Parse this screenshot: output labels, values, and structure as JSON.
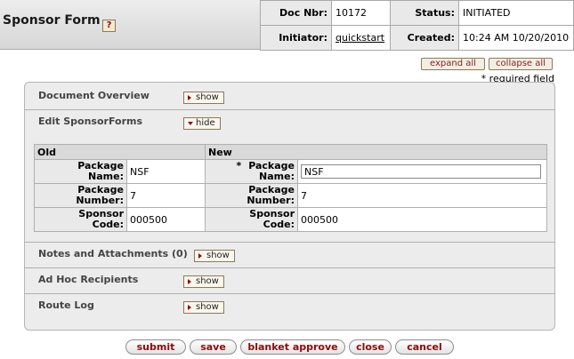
{
  "header": {
    "title": "Sponsor Form",
    "help_glyph": "?",
    "doc_nbr_label": "Doc Nbr:",
    "doc_nbr": "10172",
    "status_label": "Status:",
    "status": "INITIATED",
    "initiator_label": "Initiator:",
    "initiator": "quickstart",
    "created_label": "Created:",
    "created": "10:24 AM 10/20/2010"
  },
  "toolbar": {
    "expand_all": "expand all",
    "collapse_all": "collapse all",
    "required_note": "* required field"
  },
  "tabs": {
    "document_overview": {
      "label": "Document Overview",
      "button": "show"
    },
    "edit_sponsor_forms": {
      "label": "Edit SponsorForms",
      "button": "hide"
    },
    "notes": {
      "label": "Notes and Attachments (0)",
      "button": "show"
    },
    "ad_hoc": {
      "label": "Ad Hoc Recipients",
      "button": "show"
    },
    "route_log": {
      "label": "Route Log",
      "button": "show"
    }
  },
  "table": {
    "old_header": "Old",
    "new_header": "New",
    "required_marker": "*",
    "rows": [
      {
        "label_1": "Package",
        "label_2": "Name:",
        "old": "NSF",
        "new": "NSF"
      },
      {
        "label_1": "Package",
        "label_2": "Number:",
        "old": "7",
        "new": "7"
      },
      {
        "label_1": "Sponsor",
        "label_2": "Code:",
        "old": "000500",
        "new": "000500"
      }
    ]
  },
  "actions": {
    "submit": "submit",
    "save": "save",
    "blanket_approve": "blanket approve",
    "close": "close",
    "cancel": "cancel"
  }
}
